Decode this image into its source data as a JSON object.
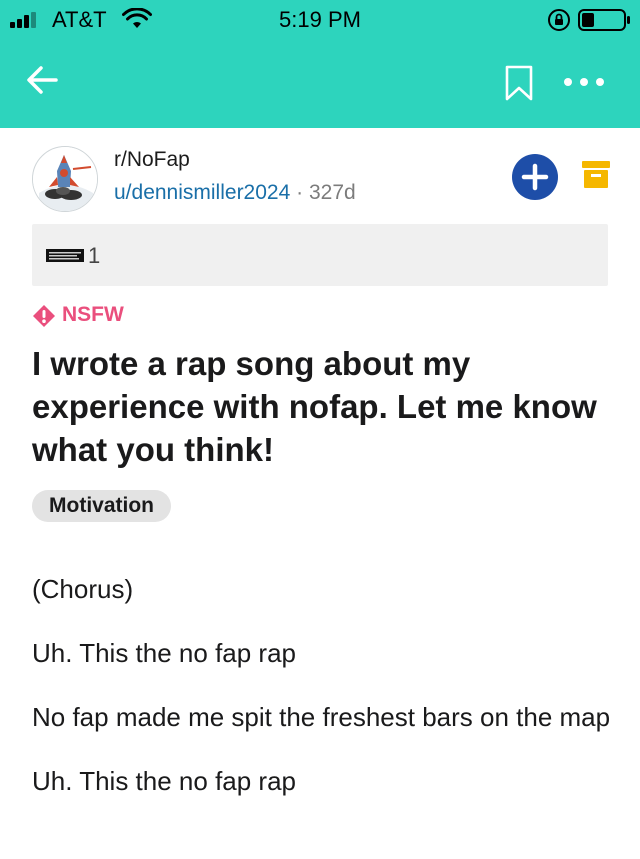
{
  "status_bar": {
    "carrier": "AT&T",
    "time": "5:19 PM"
  },
  "header": {
    "background_color": "#2dd4bd",
    "icons": [
      "back-arrow-icon",
      "bookmark-icon",
      "more-options-icon"
    ]
  },
  "post": {
    "subreddit": "r/NoFap",
    "author": "u/dennismiller2024",
    "separator": "·",
    "age": "327d",
    "award_count": "1",
    "nsfw_label": "NSFW",
    "title": "I wrote a rap song about my experience with nofap. Let me know what you think!",
    "flair": "Motivation",
    "body": [
      "(Chorus)",
      "Uh. This the no fap rap",
      "No fap made me spit the freshest bars on the map",
      "Uh. This the no fap rap"
    ]
  },
  "colors": {
    "accent_teal": "#2dd4bd",
    "join_blue": "#1e4ea8",
    "archive_orange": "#f5b700",
    "nsfw_pink": "#ea4f7d",
    "username_blue": "#1a6fa8"
  }
}
